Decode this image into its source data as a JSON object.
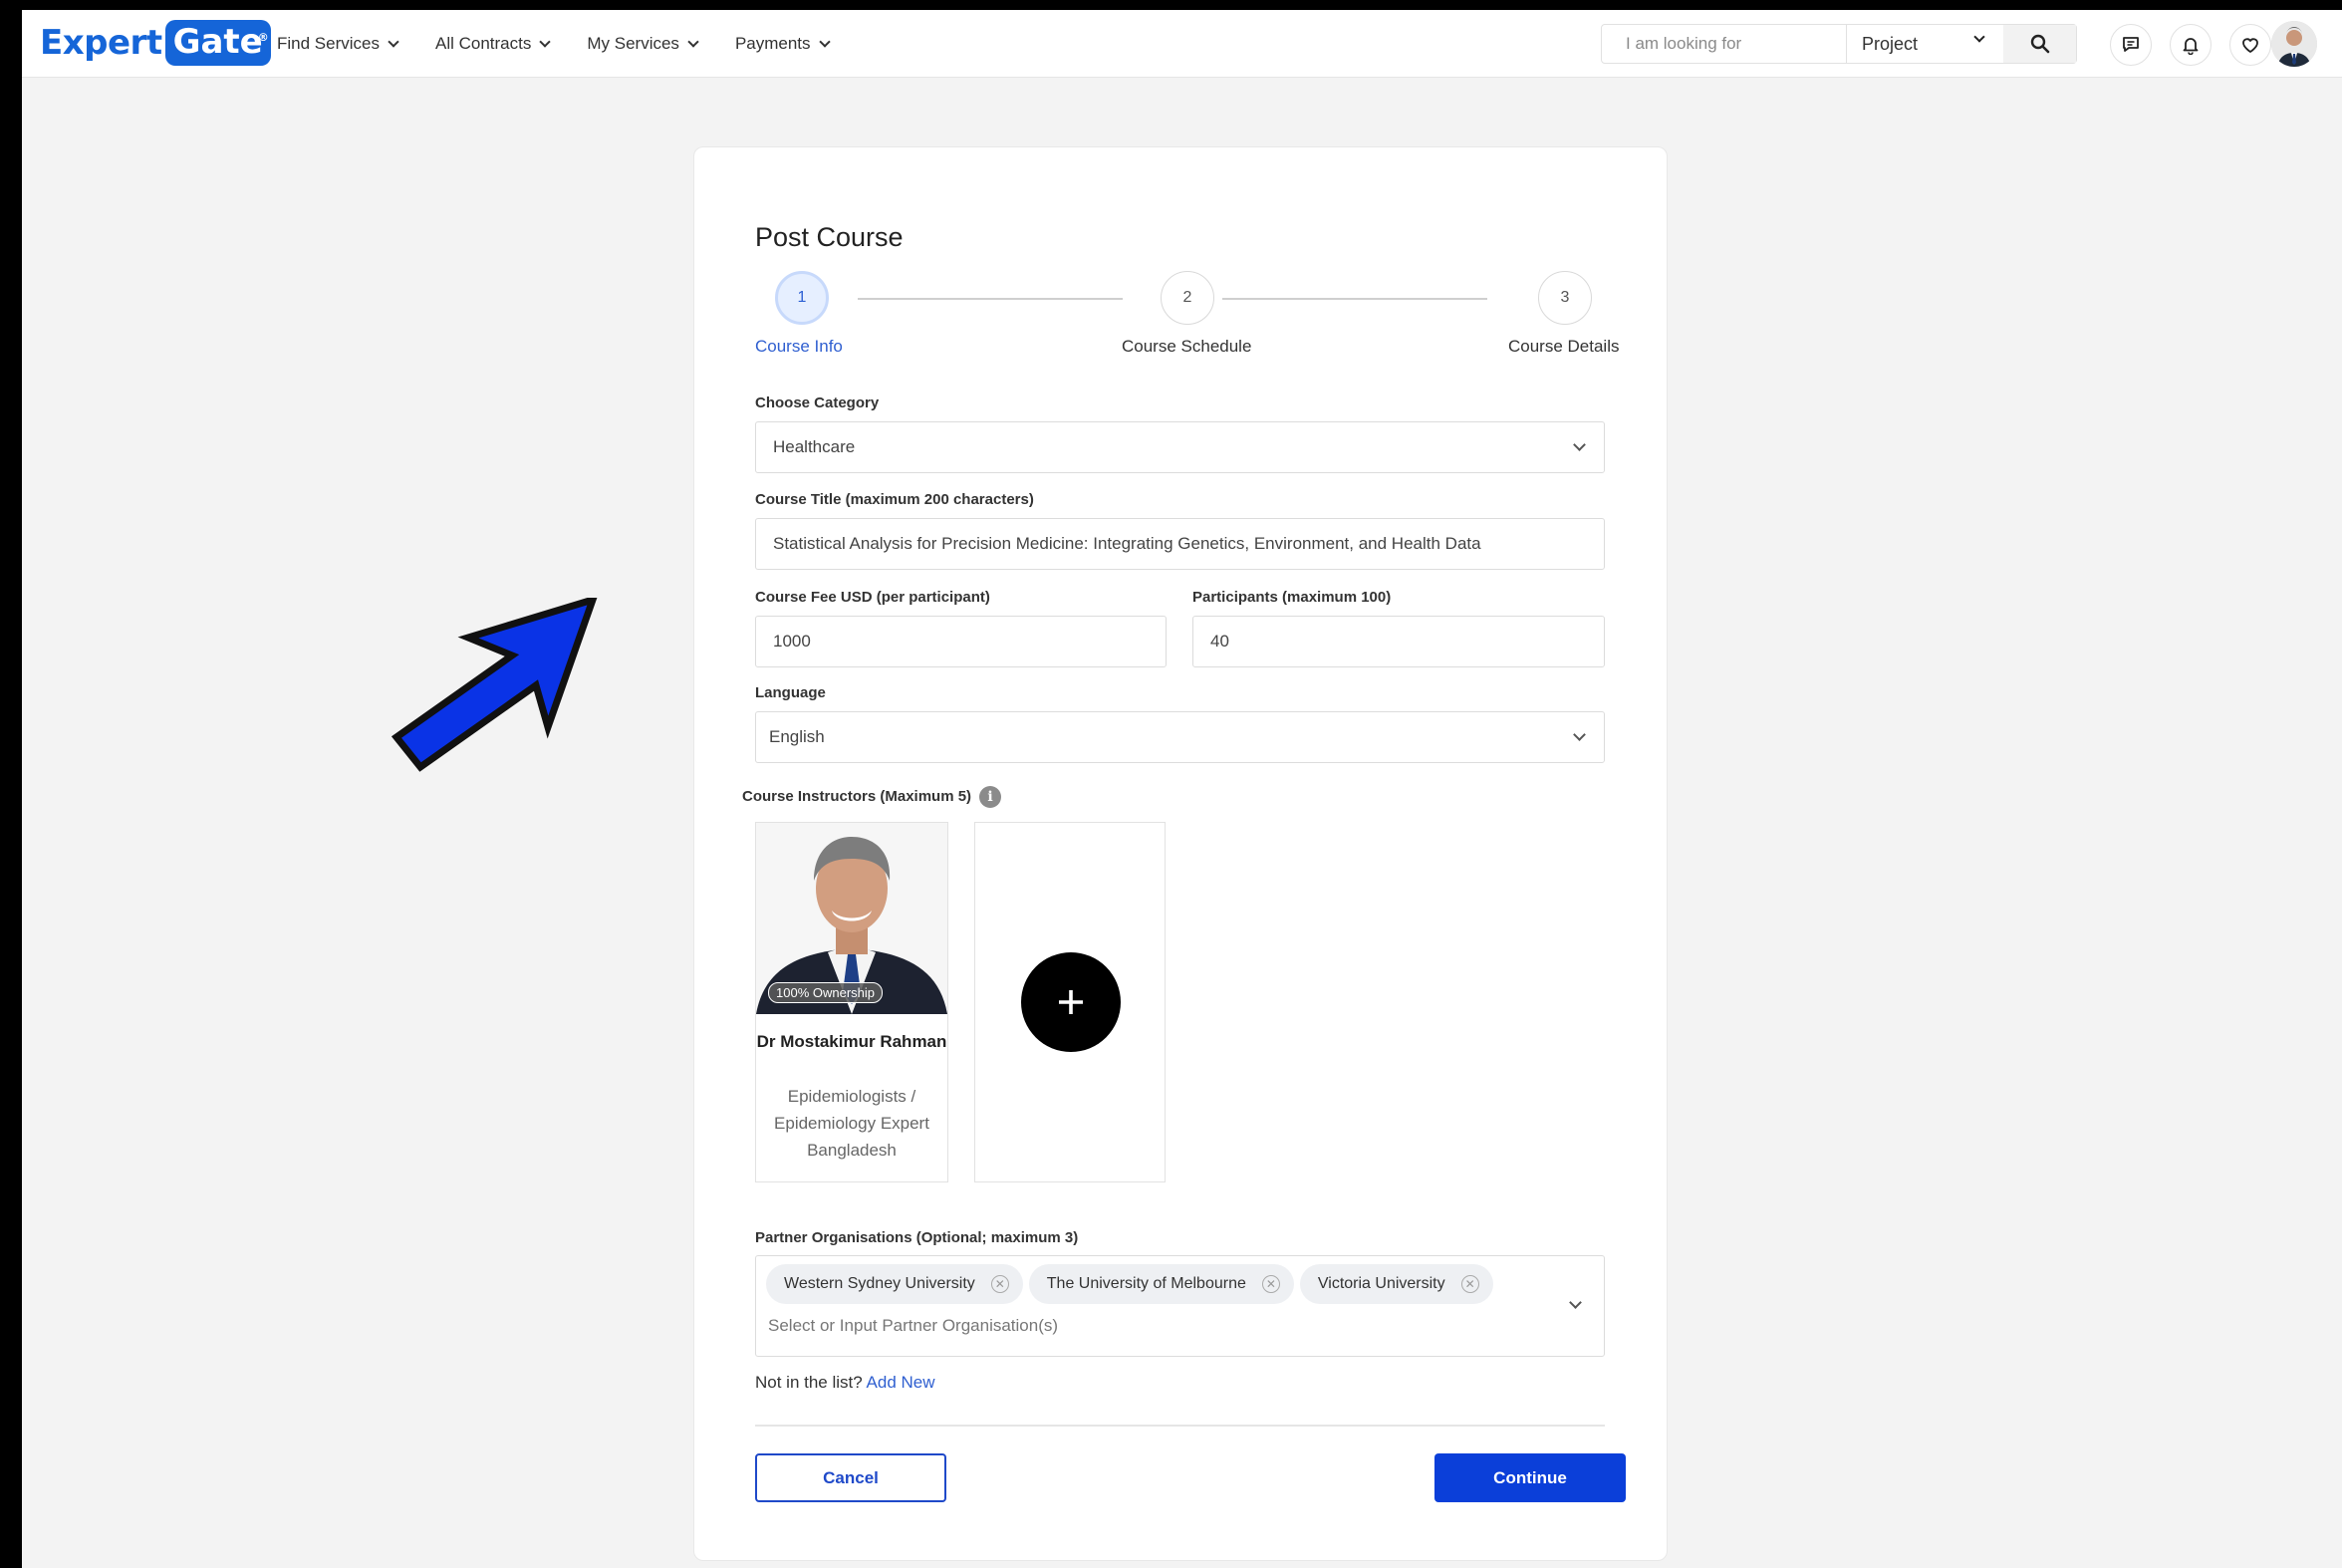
{
  "navbar": {
    "logo": {
      "expert": "Expert",
      "gate": "Gate",
      "reg": "®"
    },
    "menu": [
      {
        "label": "Find Services"
      },
      {
        "label": "All Contracts"
      },
      {
        "label": "My Services"
      },
      {
        "label": "Payments"
      }
    ],
    "search": {
      "placeholder": "I am looking for",
      "scope": "Project"
    },
    "icons": [
      "message-icon",
      "bell-icon",
      "heart-icon",
      "profile-avatar"
    ]
  },
  "form": {
    "title": "Post Course",
    "steps": [
      {
        "number": "1",
        "label": "Course Info",
        "active": true
      },
      {
        "number": "2",
        "label": "Course Schedule",
        "active": false
      },
      {
        "number": "3",
        "label": "Course Details",
        "active": false
      }
    ],
    "category": {
      "label": "Choose Category",
      "value": "Healthcare"
    },
    "course_title": {
      "label": "Course Title (maximum 200 characters)",
      "value": "Statistical Analysis for Precision Medicine: Integrating Genetics, Environment, and Health Data"
    },
    "fee": {
      "label": "Course Fee USD (per participant)",
      "value": "1000"
    },
    "participants": {
      "label": "Participants (maximum 100)",
      "value": "40"
    },
    "language": {
      "label": "Language",
      "value": "English"
    },
    "instructors": {
      "label": "Course Instructors (Maximum 5)",
      "items": [
        {
          "badge": "100% Ownership",
          "name": "Dr Mostakimur Rahman",
          "role": "Epidemiologists / Epidemiology Expert",
          "country": "Bangladesh"
        }
      ]
    },
    "partners": {
      "label": "Partner Organisations (Optional; maximum 3)",
      "chips": [
        "Western Sydney University",
        "The University of Melbourne",
        "Victoria University"
      ],
      "placeholder": "Select or Input Partner Organisation(s)"
    },
    "not_in_list": "Not in the list?",
    "add_new": "Add New",
    "cancel": "Cancel",
    "continue": "Continue"
  },
  "colors": {
    "brand": "#1565d8",
    "primary_button": "#0b3fd9",
    "arrow": "#0a33e6"
  }
}
